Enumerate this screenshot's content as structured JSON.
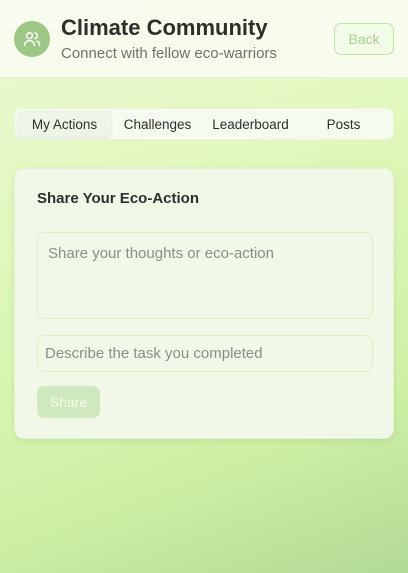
{
  "header": {
    "title": "Climate Community",
    "subtitle": "Connect with fellow eco-warriors",
    "avatar_icon": "users-icon",
    "back_label": "Back"
  },
  "tabs": [
    {
      "label": "My Actions",
      "active": true
    },
    {
      "label": "Challenges",
      "active": false
    },
    {
      "label": "Leaderboard",
      "active": false
    },
    {
      "label": "Posts",
      "active": false
    }
  ],
  "share_card": {
    "title": "Share Your Eco-Action",
    "thoughts_placeholder": "Share your thoughts or eco-action",
    "task_placeholder": "Describe the task you completed",
    "share_label": "Share"
  },
  "colors": {
    "accent": "#9dc784",
    "button_disabled": "#cfe8bd",
    "text_primary": "#2c2f2b"
  }
}
